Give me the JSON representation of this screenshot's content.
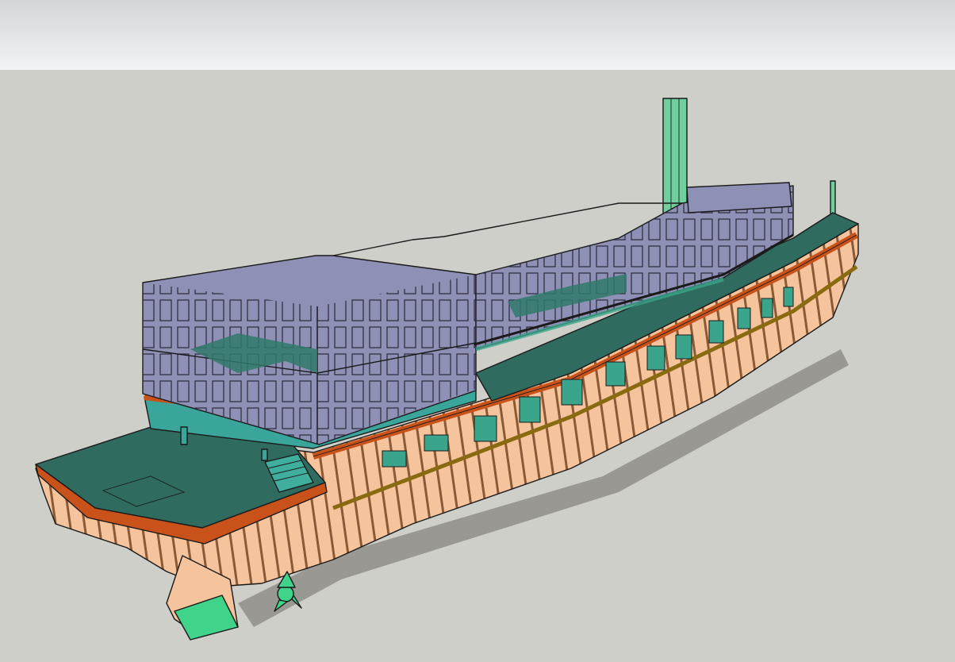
{
  "app": {
    "name": ""
  },
  "viewport": {
    "sky_color": "#e6e8ea",
    "ground_color": "#cfcfca"
  },
  "model": {
    "kind": "3d-ship-model",
    "parts": [
      {
        "name": "hull-frames",
        "color": "#f6c49c"
      },
      {
        "name": "deck",
        "color": "#2f6b5e"
      },
      {
        "name": "cabin-frames",
        "color": "#8e90b6"
      },
      {
        "name": "rail-trim",
        "color": "#c9521a"
      },
      {
        "name": "smokestack",
        "color": "#6fcf9f"
      },
      {
        "name": "propeller",
        "color": "#3fd48a"
      }
    ]
  }
}
